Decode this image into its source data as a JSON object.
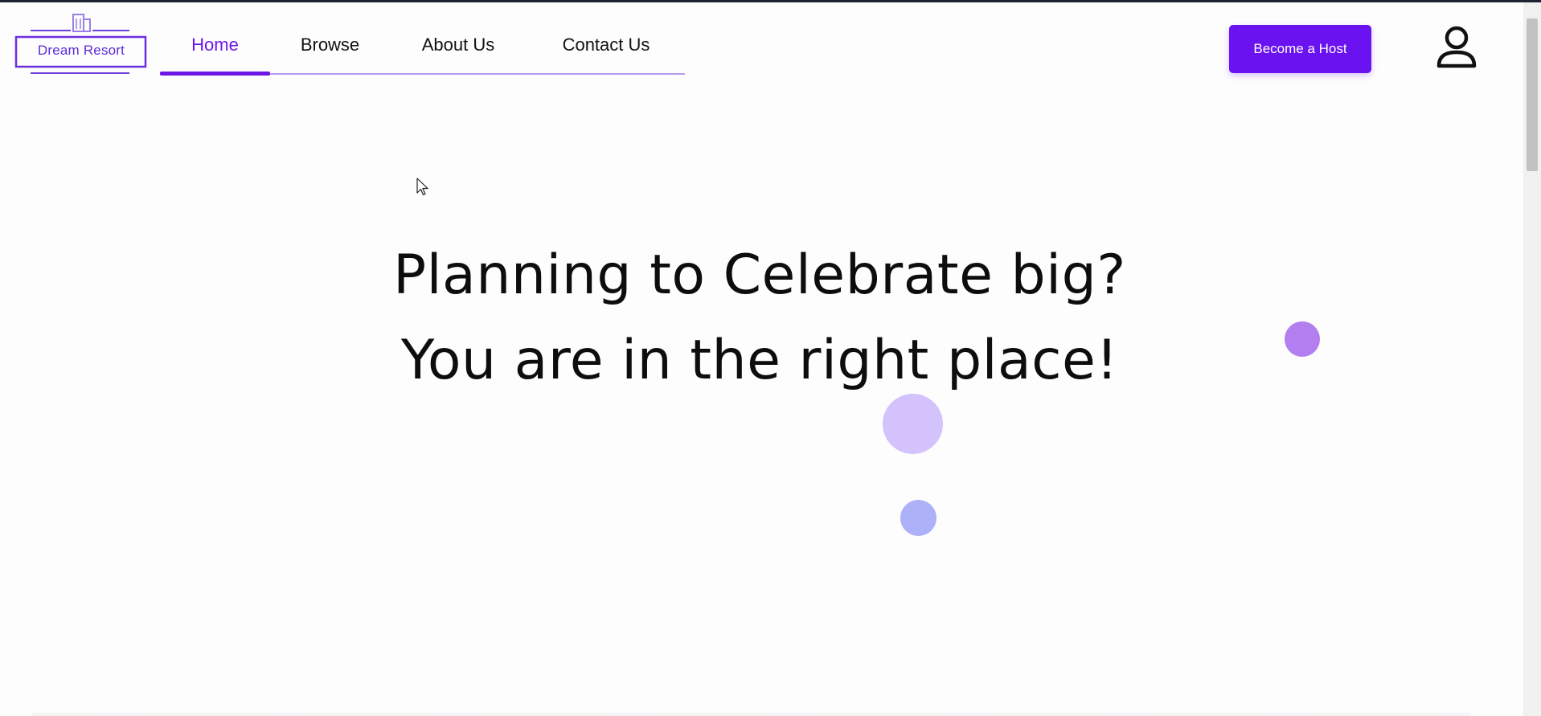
{
  "logo": {
    "text": "Dream Resort",
    "icon": "building-icon",
    "color": "#5b2bd8"
  },
  "nav": {
    "items": [
      {
        "label": "Home",
        "active": true
      },
      {
        "label": "Browse",
        "active": false
      },
      {
        "label": "About Us",
        "active": false
      },
      {
        "label": "Contact Us",
        "active": false
      }
    ],
    "accent_color": "#6b17e6"
  },
  "header": {
    "host_button_label": "Become a Host",
    "host_button_color": "#6a12f0",
    "user_icon": "user-icon"
  },
  "hero": {
    "line1": "Planning to Celebrate big?",
    "line2": "You are in the right place!"
  },
  "decor": {
    "bubble_colors": [
      "#b37ef0",
      "#d3c2fb",
      "#adb1f7"
    ]
  }
}
